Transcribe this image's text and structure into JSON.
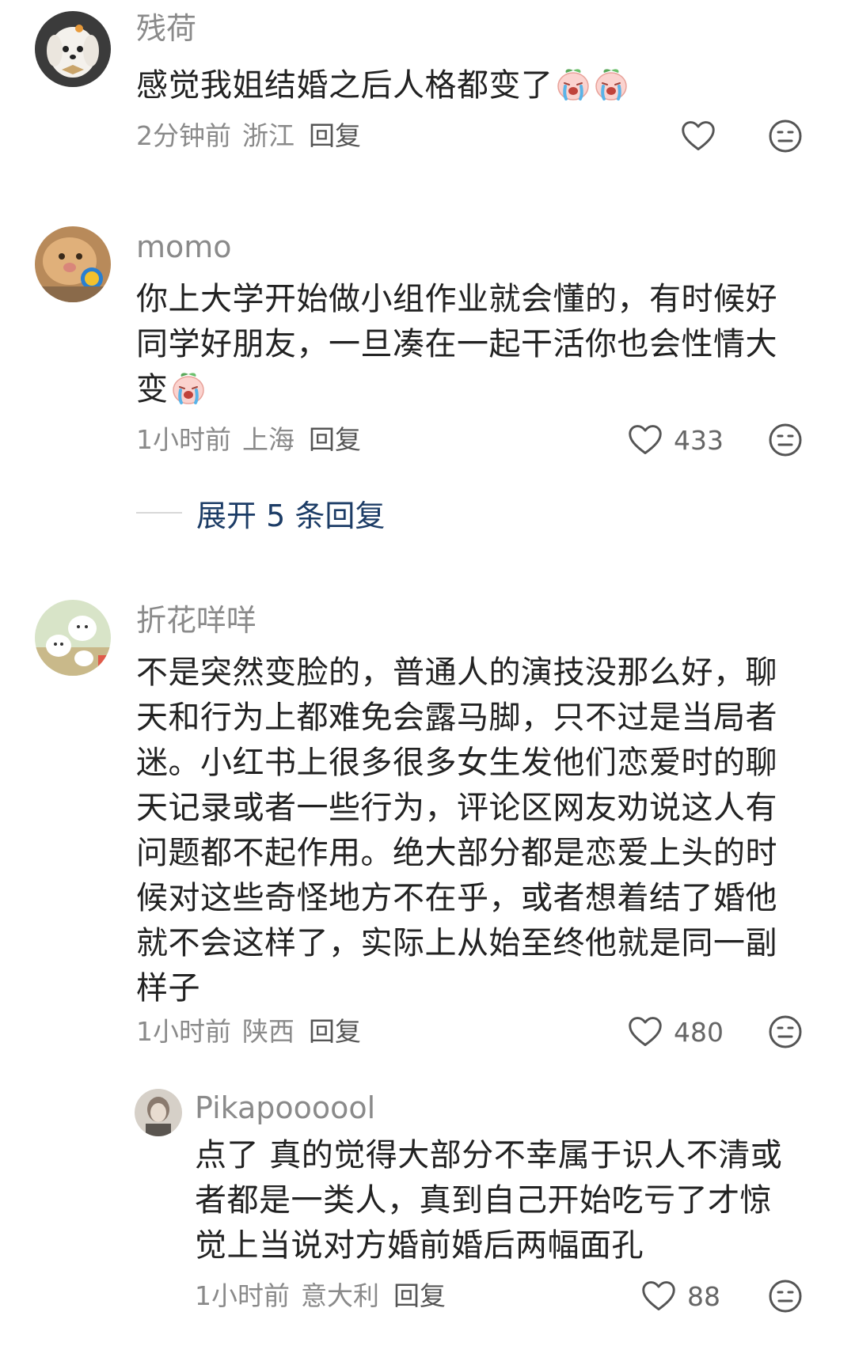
{
  "comments": [
    {
      "username": "残荷",
      "lines": [
        "感觉我姐结婚之后人格都变了"
      ],
      "emojis": [
        "crying-peach-emoji",
        "crying-peach-emoji"
      ],
      "time": "2分钟前",
      "location": "浙江",
      "reply_label": "回复",
      "likes": ""
    },
    {
      "username": "momo",
      "lines": [
        "你上大学开始做小组作业就会懂的，有时候好",
        "同学好朋友，一旦凑在一起干活你也会性情大",
        "变"
      ],
      "emojis": [
        "crying-peach-emoji"
      ],
      "time": "1小时前",
      "location": "上海",
      "reply_label": "回复",
      "likes": "433",
      "expand_label": "展开 5 条回复"
    },
    {
      "username": "折花咩咩",
      "lines": [
        "不是突然变脸的，普通人的演技没那么好，聊",
        "天和行为上都难免会露马脚，只不过是当局者",
        "迷。小红书上很多很多女生发他们恋爱时的聊",
        "天记录或者一些行为，评论区网友劝说这人有",
        "问题都不起作用。绝大部分都是恋爱上头的时",
        "候对这些奇怪地方不在乎，或者想着结了婚他",
        "就不会这样了，实际上从始至终他就是同一副",
        "样子"
      ],
      "time": "1小时前",
      "location": "陕西",
      "reply_label": "回复",
      "likes": "480"
    },
    {
      "username": "Pikapoooool",
      "lines": [
        "点了 真的觉得大部分不幸属于识人不清或",
        "者都是一类人，真到自己开始吃亏了才惊",
        "觉上当说对方婚前婚后两幅面孔"
      ],
      "time": "1小时前",
      "location": "意大利",
      "reply_label": "回复",
      "likes": "88"
    }
  ],
  "colors": {
    "username": "#8a8a8a",
    "content": "#222222",
    "expand_link": "#1c3c66",
    "icon": "#555555"
  }
}
